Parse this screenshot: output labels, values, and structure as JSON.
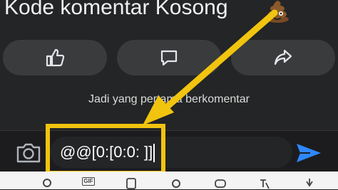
{
  "post": {
    "title": "Kode komentar Kosong",
    "title_emoji": "poop-emoji"
  },
  "actions": [
    {
      "name": "like",
      "icon": "thumbs-up-icon"
    },
    {
      "name": "comment",
      "icon": "comment-icon"
    },
    {
      "name": "share",
      "icon": "share-icon"
    }
  ],
  "hint": "Jadi yang pertama berkomentar",
  "composer": {
    "camera_icon": "camera-icon",
    "input_value": "@@[0:[0:0: ]]",
    "send_icon": "send-icon"
  },
  "keyboard": {
    "icons": [
      "search-icon",
      "gif-icon",
      "sticker-icon",
      "settings-icon",
      "game-icon",
      "translate-icon",
      "mic-icon",
      "pin-icon"
    ],
    "gif_label": "GIF"
  },
  "colors": {
    "highlight": "#f1c40f",
    "send": "#2d88ff",
    "background": "#1c1c1e"
  }
}
